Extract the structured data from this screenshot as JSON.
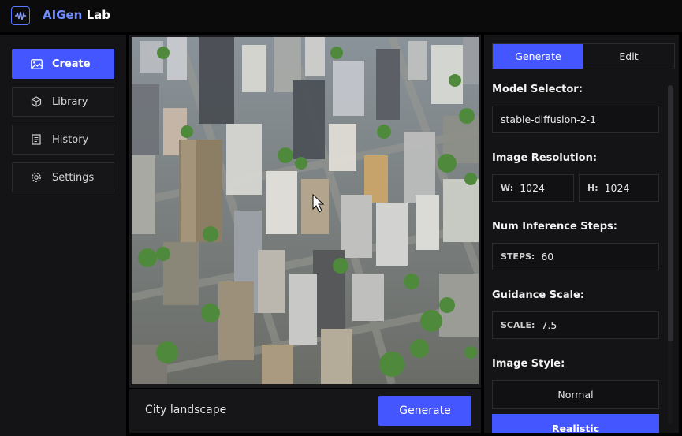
{
  "app": {
    "brand_accent": "AIGen",
    "brand_rest": " Lab",
    "logo_icon": "waveform-icon"
  },
  "sidebar": {
    "items": [
      {
        "label": "Create",
        "icon": "image-icon",
        "active": true
      },
      {
        "label": "Library",
        "icon": "cube-icon",
        "active": false
      },
      {
        "label": "History",
        "icon": "list-icon",
        "active": false
      },
      {
        "label": "Settings",
        "icon": "gear-icon",
        "active": false
      }
    ]
  },
  "canvas": {
    "alt": "Generated image: aerial city landscape"
  },
  "prompt": {
    "text": "City landscape",
    "button": "Generate"
  },
  "panel": {
    "tabs": [
      {
        "label": "Generate",
        "active": true
      },
      {
        "label": "Edit",
        "active": false
      }
    ],
    "model": {
      "label": "Model Selector:",
      "value": "stable-diffusion-2-1"
    },
    "resolution": {
      "label": "Image Resolution:",
      "w_prefix": "W:",
      "w_value": "1024",
      "h_prefix": "H:",
      "h_value": "1024"
    },
    "steps": {
      "label": "Num Inference Steps:",
      "prefix": "STEPS:",
      "value": "60"
    },
    "guidance": {
      "label": "Guidance Scale:",
      "prefix": "SCALE:",
      "value": "7.5"
    },
    "style": {
      "label": "Image Style:",
      "options": [
        {
          "label": "Normal",
          "active": false
        },
        {
          "label": "Realistic",
          "active": true
        }
      ]
    }
  },
  "colors": {
    "accent": "#4456ff",
    "background": "#000000",
    "panel": "#141416"
  }
}
